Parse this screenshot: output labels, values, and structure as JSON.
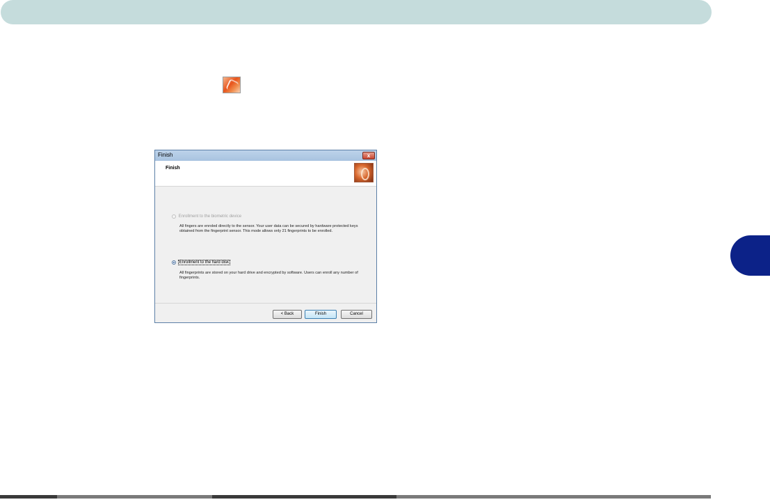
{
  "dialog": {
    "title": "Finish",
    "close_glyph": "x",
    "heading": "Finish",
    "options": [
      {
        "label": "Enrollment to the biometric device",
        "description": "All fingers are enroled directly to the sensor. Your user data can be secured by hardware protected keys obtained from the fingerprint sensor. This mode allows only 21 fingerprints to be enrolled.",
        "selected": false,
        "enabled": false
      },
      {
        "label": "Enrollment to the hard disk",
        "description": "All fingerprints are stored on your hard drive and encrypted by software. Users can enroll any number of fingerprints.",
        "selected": true,
        "enabled": true
      }
    ],
    "buttons": {
      "back": "< Back",
      "finish": "Finish",
      "cancel": "Cancel"
    }
  },
  "icons": {
    "inline": "fingerprint-app-icon",
    "banner": "fingerprint-banner-icon"
  },
  "colors": {
    "header_bar": "#c5dcdc",
    "chapter_tab": "#0c2288",
    "footer_line": "#7a7a7a"
  }
}
